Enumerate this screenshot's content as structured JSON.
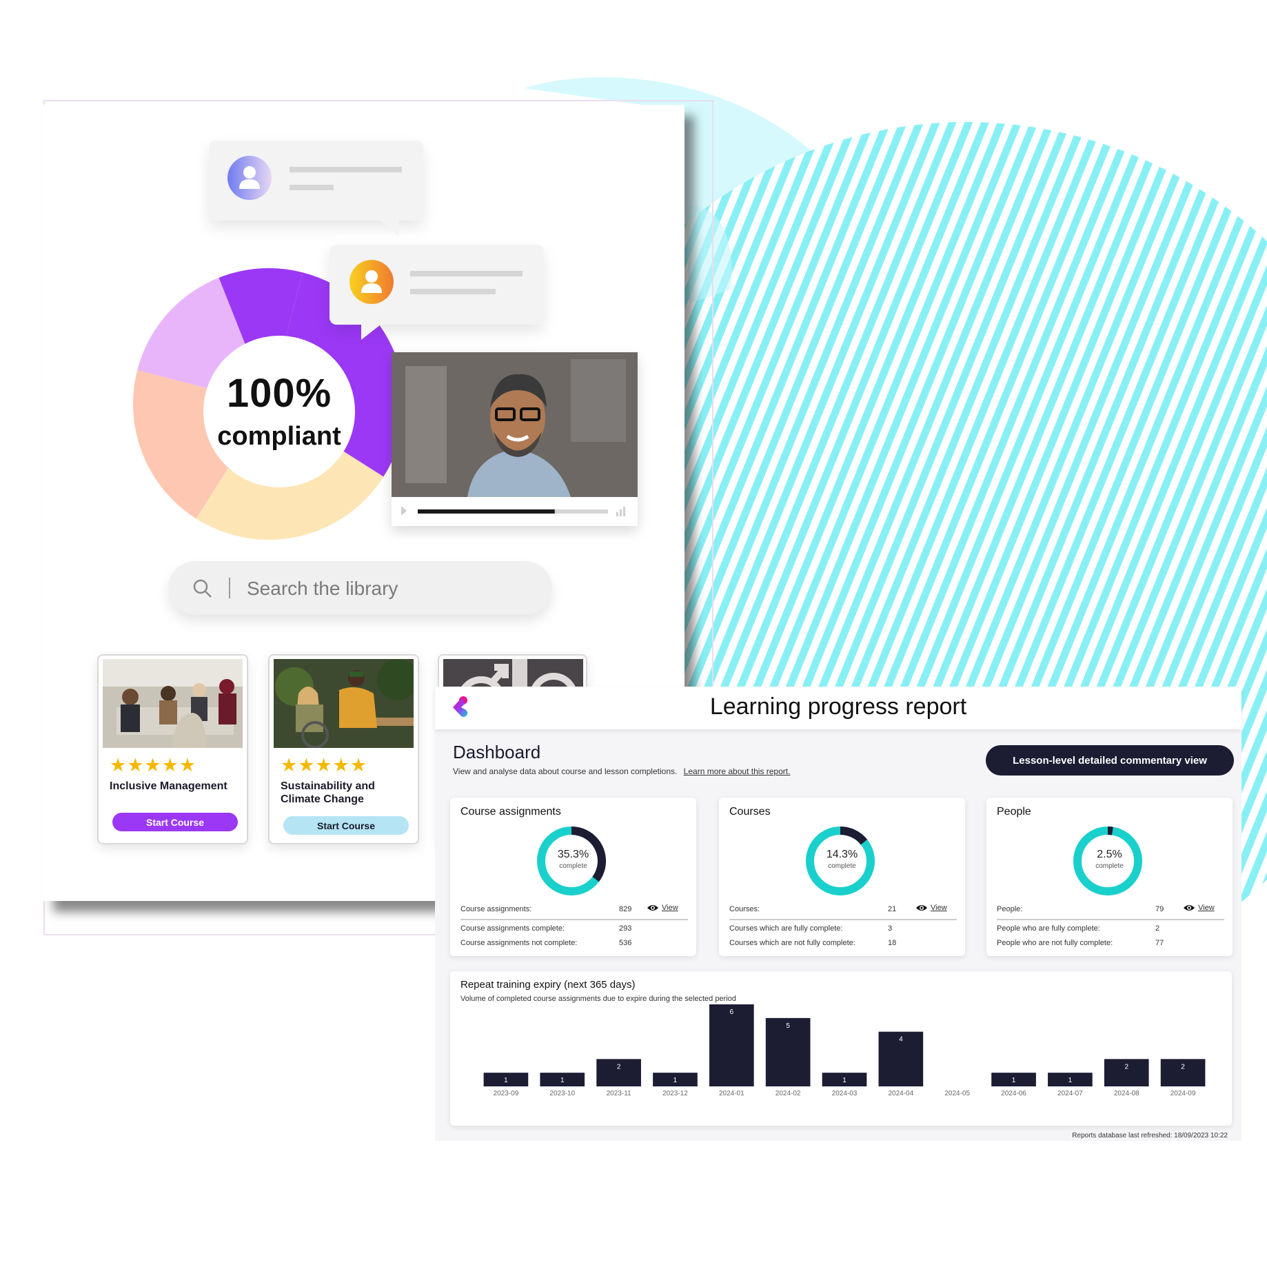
{
  "colors": {
    "accent_purple": "#9b38f5",
    "accent_cyan": "#b5e4f4",
    "teal": "#1ad0cc",
    "navy": "#1c1c33",
    "blob_cyan": "#d6f9fd",
    "stripe_cyan": "#88f0f5"
  },
  "left_panel": {
    "compliance": {
      "percent": "100%",
      "label": "compliant",
      "segments": [
        {
          "name": "purple",
          "color": "#9b38f5",
          "share": 0.3
        },
        {
          "name": "peach-yellow",
          "color": "#fde5b5",
          "share": 0.25
        },
        {
          "name": "salmon",
          "color": "#fdc7b2",
          "share": 0.2
        },
        {
          "name": "lilac",
          "color": "#e8b5fb",
          "share": 0.15
        },
        {
          "name": "purple-top",
          "color": "#9b38f5",
          "share": 0.1
        }
      ]
    },
    "video": {
      "progress": 0.72
    },
    "search": {
      "placeholder": "Search the library"
    },
    "courses": [
      {
        "title": "Inclusive Management",
        "rating": 5,
        "button": "Start Course"
      },
      {
        "title": "Sustainability and Climate Change",
        "rating": 5,
        "button": "Start Course"
      },
      {
        "title": "",
        "rating": 0,
        "button": ""
      }
    ],
    "stars": "★★★★★"
  },
  "dashboard": {
    "title": "Learning progress report",
    "heading": "Dashboard",
    "subtitle": "View and analyse data about course and lesson completions.",
    "learn_more": "Learn more about this report.",
    "detail_button": "Lesson-level detailed commentary view",
    "view_label": "View",
    "complete_label": "complete",
    "cards": [
      {
        "title": "Course assignments",
        "percent": "35.3%",
        "fraction": 0.353,
        "rows": [
          {
            "label": "Course assignments:",
            "value": "829"
          },
          {
            "label": "Course assignments complete:",
            "value": "293"
          },
          {
            "label": "Course assignments not complete:",
            "value": "536"
          }
        ]
      },
      {
        "title": "Courses",
        "percent": "14.3%",
        "fraction": 0.143,
        "rows": [
          {
            "label": "Courses:",
            "value": "21"
          },
          {
            "label": "Courses which are fully complete:",
            "value": "3"
          },
          {
            "label": "Courses which are not fully complete:",
            "value": "18"
          }
        ]
      },
      {
        "title": "People",
        "percent": "2.5%",
        "fraction": 0.025,
        "rows": [
          {
            "label": "People:",
            "value": "79"
          },
          {
            "label": "People who are fully complete:",
            "value": "2"
          },
          {
            "label": "People who are not fully complete:",
            "value": "77"
          }
        ]
      }
    ],
    "footer": "Reports database last refreshed: 18/09/2023 10:22"
  },
  "chart_data": {
    "type": "bar",
    "title": "Repeat training expiry (next 365 days)",
    "subtitle": "Volume of completed course assignments due to expire during the selected period",
    "categories": [
      "2023-09",
      "2023-10",
      "2023-11",
      "2023-12",
      "2024-01",
      "2024-02",
      "2024-03",
      "2024-04",
      "2024-05",
      "2024-06",
      "2024-07",
      "2024-08",
      "2024-09"
    ],
    "values": [
      1,
      1,
      2,
      1,
      6,
      5,
      1,
      4,
      0,
      1,
      1,
      2,
      2
    ],
    "xlabel": "",
    "ylabel": "",
    "ylim": [
      0,
      6
    ],
    "grid": false,
    "data_labels": true,
    "legend": "none"
  }
}
